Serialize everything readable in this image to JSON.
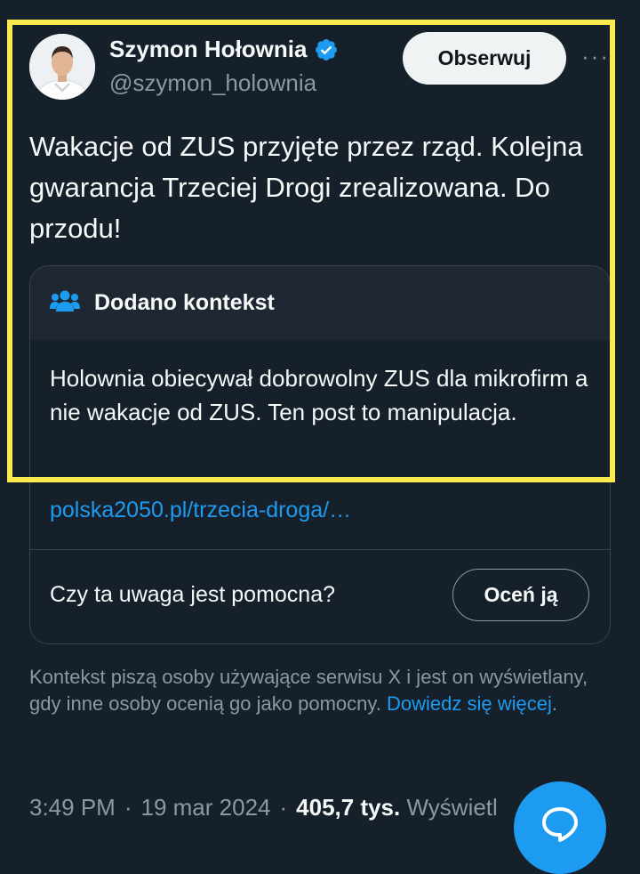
{
  "tweet": {
    "author_name": "Szymon Hołownia",
    "handle": "@szymon_holownia",
    "follow_label": "Obserwuj",
    "more_label": "···",
    "text": "Wakacje od ZUS przyjęte przez rząd. Kolejna gwarancja Trzeciej Drogi zrealizowana. Do przodu!",
    "time": "3:49 PM",
    "date": "19 mar 2024",
    "views_count": "405,7 tys.",
    "views_label": "Wyświetl"
  },
  "community_note": {
    "header": "Dodano kontekst",
    "body": "Holownia obiecywał dobrowolny ZUS dla mikrofirm a nie wakacje od ZUS. Ten post to manipulacja.",
    "link": "polska2050.pl/trzecia-droga/…",
    "helpful_question": "Czy ta uwaga jest pomocna?",
    "rate_label": "Oceń ją"
  },
  "info": {
    "text": "Kontekst piszą osoby używające serwisu X i jest on wyświetlany, gdy inne osoby ocenią go jako pomocny.",
    "learn_more": "Dowiedz się więcej",
    "end": "."
  },
  "colors": {
    "background": "#15202b",
    "accent": "#1d9bf0",
    "highlight": "#fbea4d",
    "note_header_bg": "#1e2732"
  },
  "icons": [
    "avatar",
    "verified-badge-icon",
    "more-icon",
    "community-notes-icon",
    "reply-icon"
  ]
}
